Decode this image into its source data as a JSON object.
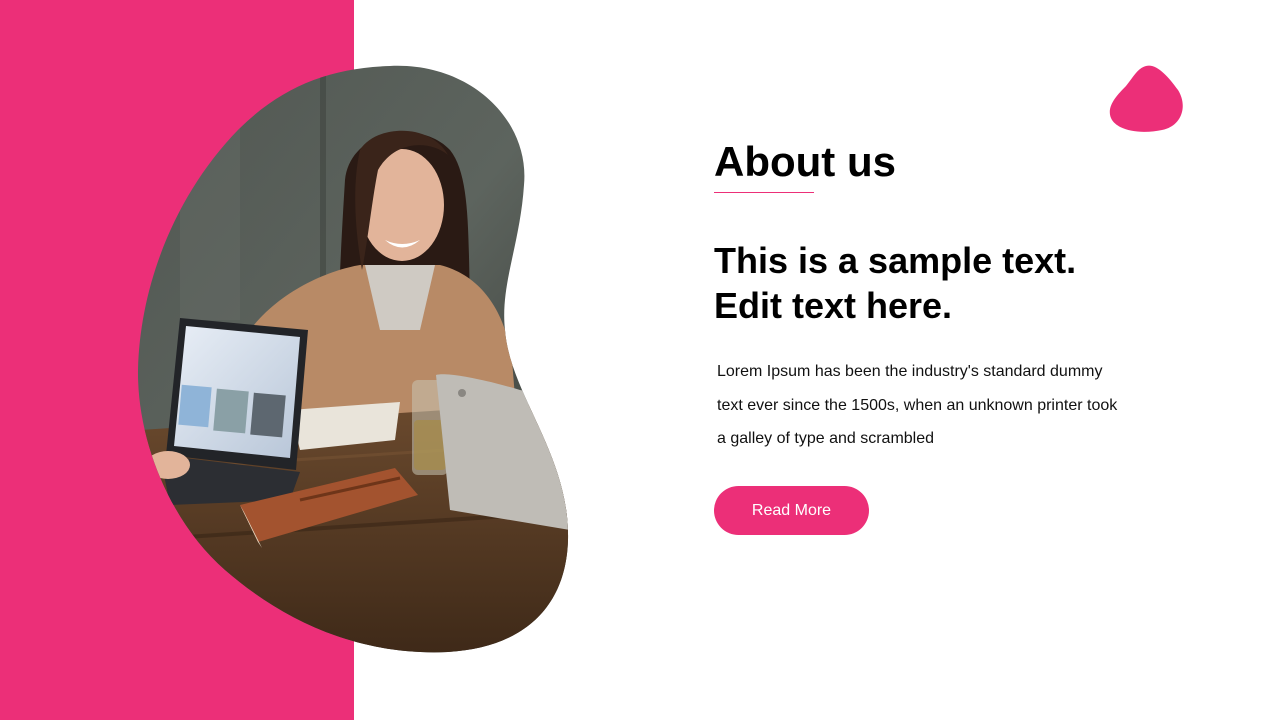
{
  "colors": {
    "accent": "#EC2F78",
    "text": "#000000",
    "background": "#FFFFFF"
  },
  "hero": {
    "image_alt": "Smiling woman working at a wooden table with laptops and a leather notebook"
  },
  "about": {
    "title": "About us",
    "headline_line1": "This is a sample text.",
    "headline_line2": "Edit text here.",
    "body_line1": "Lorem Ipsum has been the industry's standard dummy",
    "body_line2": "text ever since the 1500s, when an unknown printer took",
    "body_line3": "a galley of type and scrambled",
    "button_label": "Read More"
  }
}
